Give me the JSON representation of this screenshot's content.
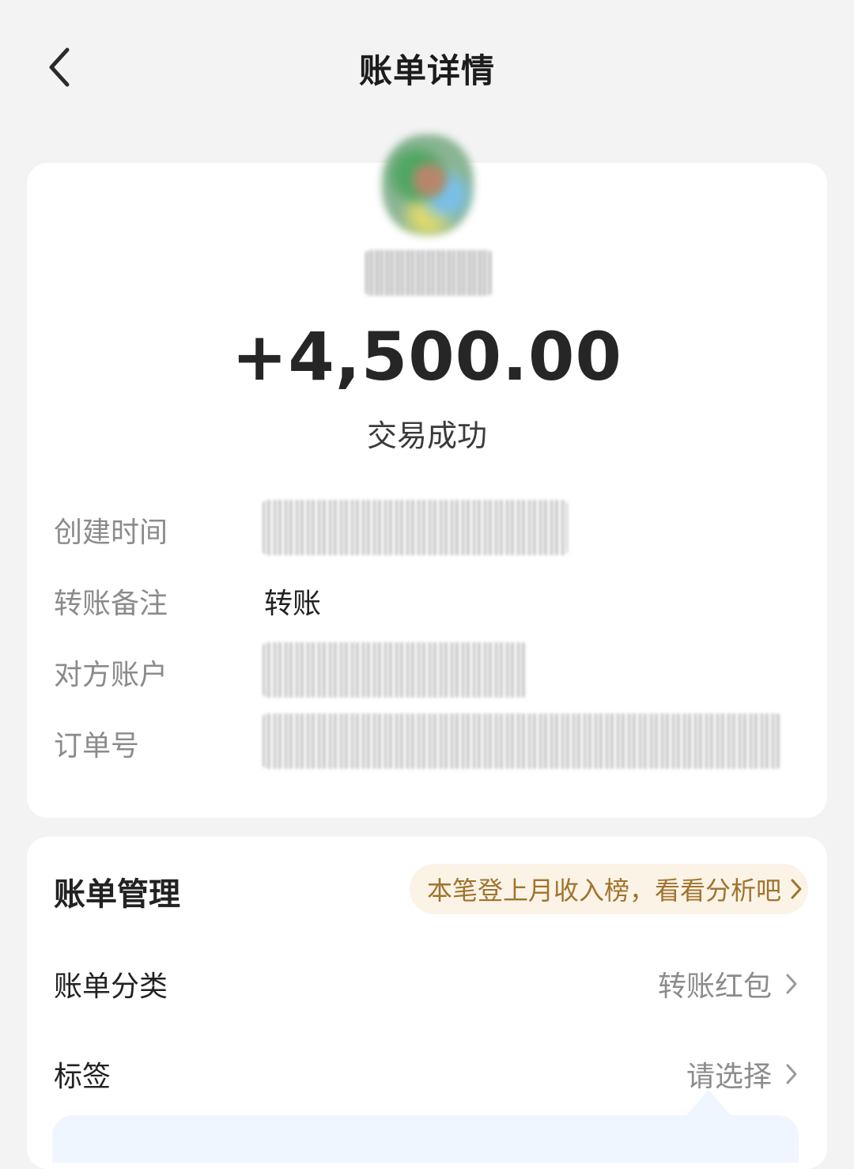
{
  "header": {
    "title": "账单详情",
    "back_icon": "chevron-left-icon"
  },
  "summary": {
    "amount": "+4,500.00",
    "status": "交易成功"
  },
  "details": {
    "created_label": "创建时间",
    "remark_label": "转账备注",
    "remark_value": "转账",
    "account_label": "对方账户",
    "order_label": "订单号"
  },
  "manage": {
    "title": "账单管理",
    "promo_text": "本笔登上月收入榜，看看分析吧",
    "category_label": "账单分类",
    "category_value": "转账红包",
    "tag_label": "标签",
    "tag_value": "请选择"
  },
  "colors": {
    "background": "#f3f3f3",
    "card": "#ffffff",
    "promo_text": "#a0732e",
    "promo_bg": "#fbf3e6"
  }
}
